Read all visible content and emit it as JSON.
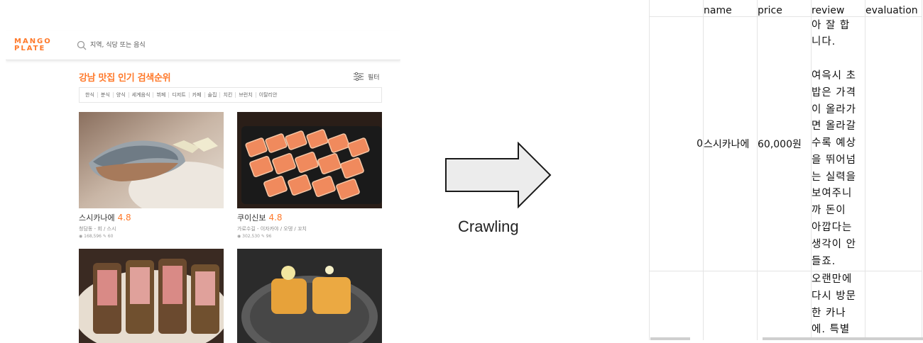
{
  "site": {
    "logo": [
      "MANGO",
      "PLATE"
    ],
    "search": {
      "placeholder": "지역, 식당 또는 음식"
    },
    "section_title": "강남 맛집 인기 검색순위",
    "filter_label": "필터",
    "categories": [
      "한식",
      "분식",
      "양식",
      "세계음식",
      "뷔페",
      "디저트",
      "카페",
      "술집",
      "치킨",
      "브런치",
      "이탈리안"
    ],
    "cards": [
      {
        "name": "스시카나에",
        "score": "4.8",
        "meta": "청담동 - 회 / 스시",
        "stats": "◉ 168,596   ✎ 60"
      },
      {
        "name": "쿠이신보",
        "score": "4.8",
        "meta": "가로수길 - 이자카야 / 오뎅 / 꼬치",
        "stats": "◉ 302,530   ✎ 96"
      },
      {
        "name": "",
        "score": "",
        "meta": "",
        "stats": ""
      },
      {
        "name": "",
        "score": "",
        "meta": "",
        "stats": ""
      }
    ]
  },
  "arrow": {
    "label": "Crawling"
  },
  "dataframe": {
    "columns": [
      "",
      "name",
      "price",
      "review",
      "evaluation"
    ],
    "rows": [
      {
        "index": "0",
        "name": "스시카나에",
        "price": "60,000원",
        "review": "아 잘 합\n니다.\n\n여윽시 초\n밥은 가격\n이 올라가\n면 올라갈\n수록 예상\n을 뛰어넘\n는 실력을\n보여주니\n까 돈이\n아깝다는\n생각이 안\n들죠.",
        "evaluation": ""
      },
      {
        "index": "",
        "name": "",
        "price": "",
        "review": "오랜만에\n다시 방문\n한 카나\n에. 특별\n한 스시의",
        "evaluation": ""
      }
    ]
  },
  "colors": {
    "brand": "#ff792a",
    "text": "#111111",
    "grid": "#e4e4e4"
  }
}
